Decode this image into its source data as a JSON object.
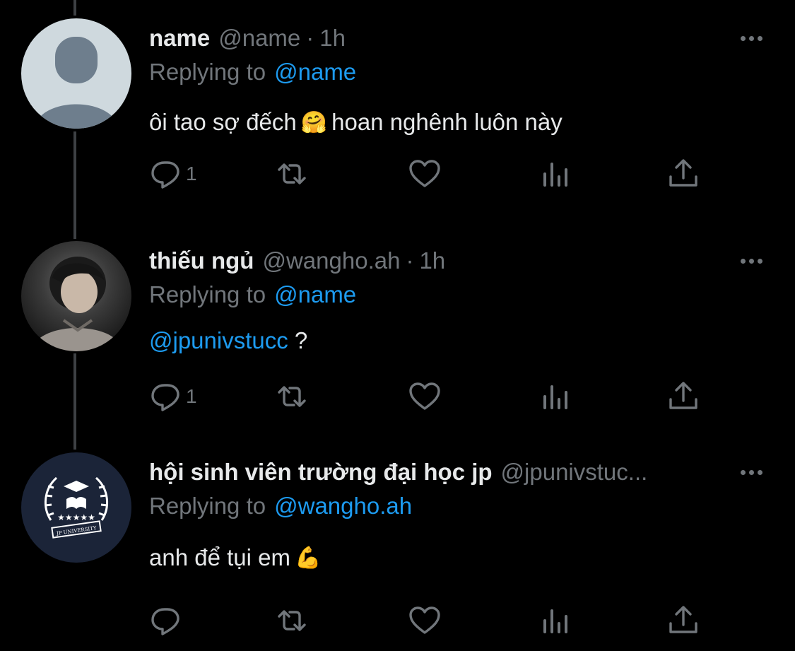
{
  "colors": {
    "background": "#000000",
    "text": "#e7e9ea",
    "muted": "#71767b",
    "link": "#1d9bf0",
    "thread_line": "#3e4144"
  },
  "tweets": [
    {
      "display_name": "name",
      "handle": "@name",
      "separator": "·",
      "time": "1h",
      "replying_label": "Replying to",
      "replying_to": "@name",
      "body_parts": [
        "ôi tao sợ đếch",
        "🤗",
        "hoan nghênh luôn này"
      ],
      "avatar": "default-avatar",
      "reply_count": "1"
    },
    {
      "display_name": "thiếu ngủ",
      "handle": "@wangho.ah",
      "separator": "·",
      "time": "1h",
      "replying_label": "Replying to",
      "replying_to": "@name",
      "body_mention": "@jpunivstucc",
      "body_text": " ?",
      "avatar": "profile-photo",
      "reply_count": "1"
    },
    {
      "display_name": "hội sinh viên trường đại học jp",
      "handle": "@jpunivstuc...",
      "replying_label": "Replying to",
      "replying_to": "@wangho.ah",
      "body_parts": [
        "anh để tụi em",
        "💪"
      ],
      "avatar": "jp-university-logo",
      "logo_text": "JP UNIVERSITY",
      "reply_count": ""
    }
  ],
  "icons": [
    "reply-icon",
    "retweet-icon",
    "like-icon",
    "views-icon",
    "share-icon",
    "more-icon"
  ]
}
